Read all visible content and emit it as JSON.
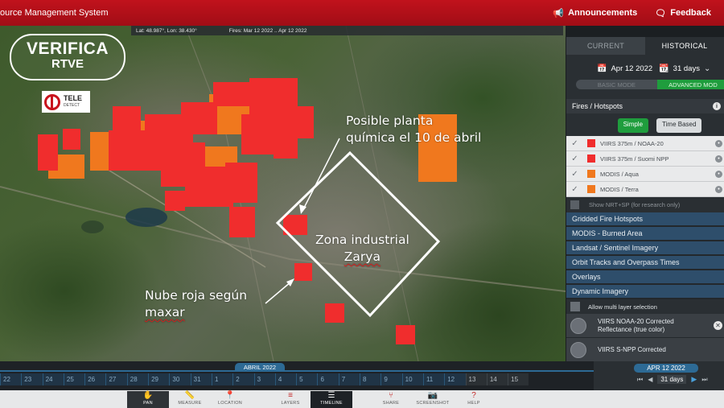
{
  "header": {
    "title": "ource Management System",
    "announcements_label": "Announcements",
    "feedback_label": "Feedback"
  },
  "map": {
    "coords_text": "Lat: 48.987°, Lon: 38.430°",
    "fires_range": "Fires: Mar 12 2022 .. Apr 12 2022",
    "logo_line1": "VERIFICA",
    "logo_line2": "RTVE",
    "tele_logo_line1": "TELE",
    "tele_logo_line2": "DETECT",
    "annotation_plant": [
      "Posible planta",
      "química el 10 de abril"
    ],
    "annotation_zone": [
      "Zona industrial",
      "Zarya"
    ],
    "annotation_cloud": [
      "Nube roja según",
      "maxar"
    ],
    "colors": {
      "viirs": "#f02d2d",
      "modis": "#f0781e",
      "annotation": "#ffffff"
    }
  },
  "panel": {
    "tabs": [
      {
        "label": "CURRENT",
        "active": false
      },
      {
        "label": "HISTORICAL",
        "active": true
      }
    ],
    "date": "Apr 12 2022",
    "range": "31 days",
    "mode_basic": "BASIC MODE",
    "mode_advanced": "ADVANCED MOD",
    "fires_header": "Fires / Hotspots",
    "filter_simple": "Simple",
    "filter_timebased": "Time Based",
    "layers": [
      {
        "label": "VIIRS 375m / NOAA-20",
        "color": "#f02d2d"
      },
      {
        "label": "VIIRS 375m / Suomi NPP",
        "color": "#f02d2d"
      },
      {
        "label": "MODIS / Aqua",
        "color": "#f0781e"
      },
      {
        "label": "MODIS / Terra",
        "color": "#f0781e"
      }
    ],
    "nrt_label": "Show NRT+SP (for research only)",
    "categories": [
      "Gridded Fire Hotspots",
      "MODIS - Burned Area",
      "Landsat / Sentinel Imagery",
      "Orbit Tracks and Overpass Times",
      "Overlays",
      "Dynamic Imagery"
    ],
    "allow_multi": "Allow multi layer selection",
    "imagery_items": [
      {
        "thumb": "20",
        "line1": "VIIRS NOAA-20 Corrected",
        "line2": "Reflectance (true color)"
      },
      {
        "thumb": "",
        "line1": "VIIRS S-NPP Corrected",
        "line2": ""
      }
    ]
  },
  "timeline": {
    "month_label": "ABRIL 2022",
    "days": [
      "22",
      "23",
      "24",
      "25",
      "26",
      "27",
      "28",
      "29",
      "30",
      "31",
      "1",
      "2",
      "3",
      "4",
      "5",
      "6",
      "7",
      "8",
      "9",
      "10",
      "11",
      "12",
      "13",
      "14",
      "15"
    ],
    "selected_date": "APR 12 2022",
    "range": "31 days"
  },
  "toolbar": {
    "tools": [
      {
        "label": "PAN",
        "icon": "hand-icon"
      },
      {
        "label": "MEASURE",
        "icon": "ruler-icon"
      },
      {
        "label": "LOCATION",
        "icon": "pin-icon"
      },
      {
        "label": "LAYERS",
        "icon": "layers-icon"
      },
      {
        "label": "TIMELINE",
        "icon": "sliders-icon"
      },
      {
        "label": "SHARE",
        "icon": "share-icon"
      },
      {
        "label": "SCREENSHOT",
        "icon": "camera-icon"
      },
      {
        "label": "HELP",
        "icon": "help-icon"
      }
    ]
  }
}
